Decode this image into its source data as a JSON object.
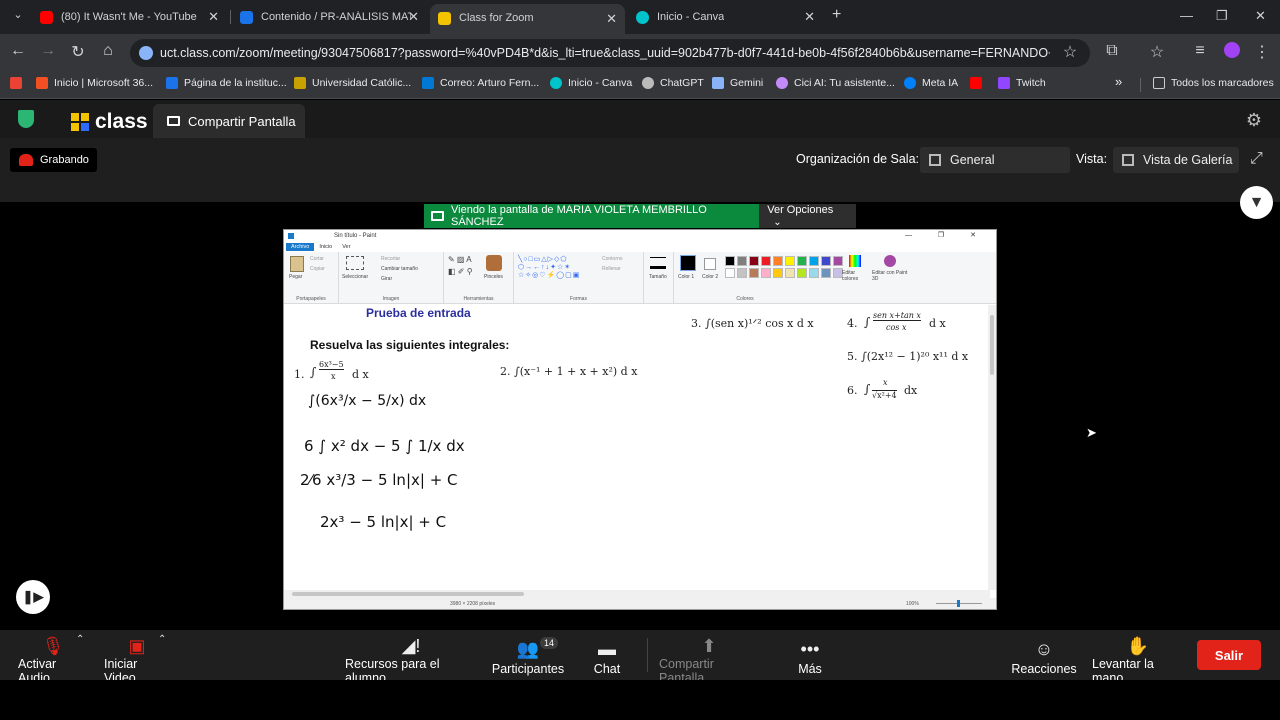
{
  "browser": {
    "tabs": [
      {
        "title": "(80) It Wasn't Me - YouTube",
        "icon": "youtube-icon",
        "color": "#ff0000"
      },
      {
        "title": "Contenido / PR-ANÁLISIS MATE",
        "icon": "blackboard-icon",
        "color": "#1a73e8"
      },
      {
        "title": "Class for Zoom",
        "icon": "class-icon",
        "color": "#f5c400"
      },
      {
        "title": "Inicio - Canva",
        "icon": "canva-icon",
        "color": "#00c4cc"
      }
    ],
    "new_tab": "+",
    "url": "uct.class.com/zoom/meeting/93047506817?password=%40vPD4B*d&is_lti=true&class_uuid=902b477b-d0f7-441d-be0b-4f56f2840b6b&username=FERNANDO+FRANCO...",
    "bookmarks": [
      {
        "label": "Inicio | Microsoft 36...",
        "color": "#f25022"
      },
      {
        "label": "Página de la instituc...",
        "color": "#1a73e8"
      },
      {
        "label": "Universidad Católic...",
        "color": "#c8a200"
      },
      {
        "label": "Correo: Arturo Fern...",
        "color": "#0078d4"
      },
      {
        "label": "Inicio - Canva",
        "color": "#00c4cc"
      },
      {
        "label": "ChatGPT",
        "color": "#bbbbbb"
      },
      {
        "label": "Gemini",
        "color": "#8ab4f8"
      },
      {
        "label": "Cici AI: Tu asistente...",
        "color": "#c58af9"
      },
      {
        "label": "Meta IA",
        "color": "#0081fb"
      },
      {
        "label": "",
        "color": "#ff0000"
      },
      {
        "label": "Twitch",
        "color": "#9146ff"
      }
    ],
    "more_bookmarks": "»",
    "all_bookmarks": "Todos los marcadores"
  },
  "classapp": {
    "logo": "class",
    "share_tab": "Compartir Pantalla",
    "recording": "Grabando",
    "org_label": "Organización de Sala:",
    "org_value": "General",
    "view_label": "Vista:",
    "view_value": "Vista de Galería",
    "viewing_text": "Viendo la pantalla de MARIA VIOLETA MEMBRILLO SÁNCHEZ",
    "view_options": "Ver Opciones"
  },
  "paint": {
    "title": "Sin título - Paint",
    "tabs": [
      "Archivo",
      "Inicio",
      "Ver"
    ],
    "groups": [
      "Portapapeles",
      "Imagen",
      "Herramientas",
      "Formas",
      "Colores"
    ],
    "clipboard": {
      "paste": "Pegar",
      "cut": "Cortar",
      "copy": "Copiar"
    },
    "image": {
      "select": "Seleccionar",
      "crop": "Recortar",
      "resize": "Cambiar tamaño",
      "rotate": "Girar"
    },
    "brushes": "Pinceles",
    "outline": "Contorno",
    "fill": "Rellenar",
    "size": "Tamaño",
    "color1": "Color 1",
    "color2": "Color 2",
    "edit_colors": "Editar colores",
    "edit_3d": "Editar con Paint 3D",
    "palette": [
      "#000000",
      "#7f7f7f",
      "#880015",
      "#ed1c24",
      "#ff7f27",
      "#fff200",
      "#22b14c",
      "#00a2e8",
      "#3f48cc",
      "#a349a4",
      "#ffffff",
      "#c3c3c3",
      "#b97a57",
      "#ffaec9",
      "#ffc90e",
      "#efe4b0",
      "#b5e61d",
      "#99d9ea",
      "#7092be",
      "#c8bfe7"
    ],
    "status_size": "3980 × 2208 píxeles",
    "zoom": "100%",
    "doc": {
      "heading": "Prueba de entrada",
      "instruction": "Resuelva las siguientes integrales:",
      "p1_num": "1.",
      "p1_int": "∫",
      "p1_num_frac": "6x³−5",
      "p1_den_frac": "x",
      "p1_dx": "d x",
      "p2": "2.  ∫(x⁻¹ + 1 + x + x²) d x",
      "p3": "3.  ∫(sen x)¹ᐟ² cos x d x",
      "p4_num": "4.",
      "p4_top": "sen x+tan x",
      "p4_bot": "cos x",
      "p4_dx": "d x",
      "p5": "5.  ∫(2x¹² − 1)²⁰ x¹¹ d x",
      "p6_num": "6.",
      "p6_top": "x",
      "p6_bot": "√x²+4",
      "p6_dx": "dx",
      "hw1": "∫(6x³/x − 5/x) dx",
      "hw2": "6 ∫ x² dx − 5 ∫ 1/x dx",
      "hw3": "2⁄6 x³/3 − 5 ln|x| + C",
      "hw4": "2x³ − 5 ln|x| + C"
    }
  },
  "controls": {
    "audio": "Activar Audio",
    "video": "Iniciar Video",
    "resources": "Recursos para el alumno",
    "participants": "Participantes",
    "participants_count": "14",
    "chat": "Chat",
    "share": "Compartir Pantalla",
    "more": "Más",
    "reactions": "Reacciones",
    "raise_hand": "Levantar la mano",
    "leave": "Salir"
  }
}
